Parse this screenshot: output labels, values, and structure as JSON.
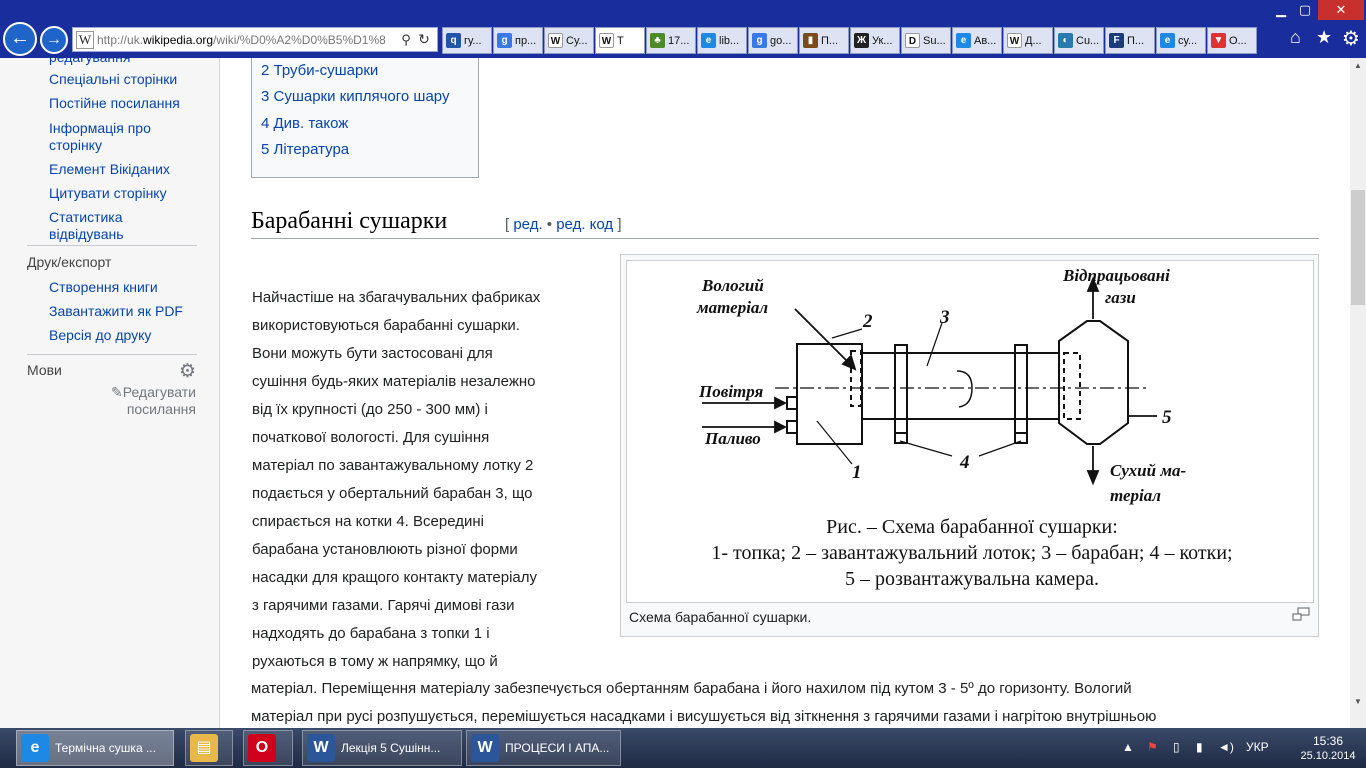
{
  "window": {
    "minimize": "▁",
    "maximize": "▢",
    "close": "✕"
  },
  "browser": {
    "back_glyph": "←",
    "forward_glyph": "→",
    "address_prefix": "http://uk.",
    "address_domain": "wikipedia.org",
    "address_rest": "/wiki/%D0%A2%D0%B5%D1%8",
    "site_icon_glyph": "W",
    "tabs": [
      {
        "icon": "search-icon",
        "glyph": "q",
        "color": "#2255aa",
        "label": "гу..."
      },
      {
        "icon": "google-icon",
        "glyph": "g",
        "color": "#3b78e7",
        "label": "пр..."
      },
      {
        "icon": "wikipedia-icon",
        "glyph": "W",
        "color": "#ffffff",
        "label": "Су..."
      },
      {
        "icon": "wikipedia-icon",
        "glyph": "W",
        "color": "#ffffff",
        "label": "Т"
      },
      {
        "icon": "tree-icon",
        "glyph": "♣",
        "color": "#4d8a2a",
        "label": "17..."
      },
      {
        "icon": "ie-icon",
        "glyph": "e",
        "color": "#1e88e5",
        "label": "lib..."
      },
      {
        "icon": "google-icon",
        "glyph": "g",
        "color": "#3b78e7",
        "label": "go..."
      },
      {
        "icon": "book-icon",
        "glyph": "▮",
        "color": "#7a4a1a",
        "label": "П..."
      },
      {
        "icon": "grid-icon",
        "glyph": "Ж",
        "color": "#222222",
        "label": "Ук..."
      },
      {
        "icon": "d-icon",
        "glyph": "D",
        "color": "#ffffff",
        "label": "Su..."
      },
      {
        "icon": "ie-icon",
        "glyph": "e",
        "color": "#1e88e5",
        "label": "Ав..."
      },
      {
        "icon": "wikipedia-icon",
        "glyph": "W",
        "color": "#ffffff",
        "label": "Д..."
      },
      {
        "icon": "globe-icon",
        "glyph": "◐",
        "color": "#2a7ab0",
        "label": "Cu..."
      },
      {
        "icon": "f-icon",
        "glyph": "F",
        "color": "#1a3c7a",
        "label": "П..."
      },
      {
        "icon": "ie-icon",
        "glyph": "e",
        "color": "#1e88e5",
        "label": "су..."
      },
      {
        "icon": "pocket-icon",
        "glyph": "▼",
        "color": "#d33",
        "label": "О..."
      }
    ],
    "home_glyph": "⌂",
    "favorites_glyph": "★",
    "tools_glyph": "⚙"
  },
  "sidebar": {
    "partial_top": "редагування",
    "tools": [
      "Спеціальні сторінки",
      "Постійне посилання",
      "Інформація про сторінку",
      "Елемент Вікіданих",
      "Цитувати сторінку",
      "Статистика відвідувань"
    ],
    "print_heading": "Друк/експорт",
    "print_links": [
      "Створення книги",
      "Завантажити як PDF",
      "Версія до друку"
    ],
    "langs_heading": "Мови",
    "edit_links": "Редагувати посилання"
  },
  "toc": {
    "items": [
      "2 Труби-сушарки",
      "3 Сушарки киплячого шару",
      "4 Див. також",
      "5 Література"
    ]
  },
  "section": {
    "title": "Барабанні сушарки",
    "edit_open": "[",
    "edit": "ред.",
    "edit_sep": " • ",
    "edit_source": "ред. код",
    "edit_close": "]",
    "paragraph_lines": [
      "Найчастіше на збагачувальних фабриках",
      "використовуються барабанні сушарки.",
      "Вони можуть бути застосовані для",
      "сушіння будь-яких матеріалів незалежно",
      "від їх крупності (до 250 - 300 мм) і",
      "початкової вологості. Для сушіння",
      "матеріал по завантажувальному лотку 2",
      "подається у обертальний барабан 3, що",
      "спирається на котки 4. Всередині",
      "барабана установлюють різної форми",
      "насадки для кращого контакту матеріалу",
      "з гарячими газами. Гарячі димові гази",
      "надходять до барабана з топки 1 і",
      "рухаються в тому ж напрямку, що й"
    ],
    "paragraph_wide_lines": [
      "матеріал. Переміщення матеріалу забезпечується обертанням барабана і його нахилом під кутом 3 - 5º до горизонту. Вологий",
      "матеріал при русі розпушується, перемішується насадками і висушується від зіткнення з гарячими газами і нагрітою внутрішньою"
    ]
  },
  "figure": {
    "label_wet_1": "Вологий",
    "label_wet_2": "матеріал",
    "label_exhaust_1": "Відпрацьовані",
    "label_exhaust_2": "гази",
    "label_air": "Повітря",
    "label_fuel": "Паливо",
    "label_dry_1": "Сухий ма-",
    "label_dry_2": "теріал",
    "num_1": "1",
    "num_2": "2",
    "num_3": "3",
    "num_4": "4",
    "num_5": "5",
    "caption_line1": "Рис. – Схема барабанної сушарки:",
    "caption_line2": "1- топка; 2 – завантажувальний лоток; 3 – барабан; 4 – котки;",
    "caption_line3": "5 – розвантажувальна камера.",
    "thumb_caption": "Схема барабанної сушарки."
  },
  "taskbar": {
    "items": [
      {
        "icon": "ie-icon",
        "glyph": "e",
        "color": "#1e88e5",
        "label": "Термічна сушка ..."
      },
      {
        "icon": "folder-icon",
        "glyph": "▤",
        "color": "#e8b84a",
        "label": ""
      },
      {
        "icon": "opera-icon",
        "glyph": "O",
        "color": "#d0021b",
        "label": ""
      },
      {
        "icon": "word-icon",
        "glyph": "W",
        "color": "#2b579a",
        "label": "Лекція 5 Сушінн..."
      },
      {
        "icon": "word-icon",
        "glyph": "W",
        "color": "#2b579a",
        "label": "ПРОЦЕСИ І АПА..."
      }
    ],
    "tray": {
      "up_arrow": "▲",
      "flag": "⚑",
      "battery": "▯",
      "signal": "▮",
      "volume": "◄)",
      "lang": "УКР"
    },
    "time": "15:36",
    "date": "25.10.2014"
  }
}
